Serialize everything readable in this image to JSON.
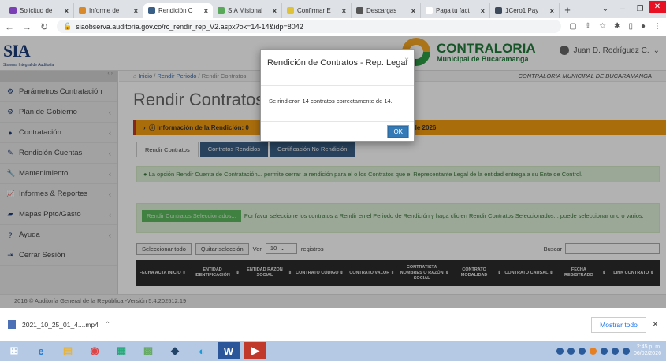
{
  "browser": {
    "tabs": [
      {
        "label": "Solicitud de",
        "color": "#7b3fb5",
        "active": false
      },
      {
        "label": "Informe de",
        "color": "#d9882a",
        "active": false
      },
      {
        "label": "Rendición C",
        "color": "#3a5f86",
        "active": true
      },
      {
        "label": "SIA Misional",
        "color": "#5aa85a",
        "active": false
      },
      {
        "label": "Confirmar E",
        "color": "#e0c23a",
        "active": false
      },
      {
        "label": "Descargas",
        "color": "#555555",
        "active": false
      },
      {
        "label": "Paga tu fact",
        "color": "#ffffff",
        "active": false
      },
      {
        "label": "1Cero1 Pay",
        "color": "#3c4a5c",
        "active": false
      }
    ],
    "new_tab": "+",
    "url": "siaobserva.auditoria.gov.co/rc_rendir_rep_V2.aspx?ok=14-14&idp=8042"
  },
  "header": {
    "logo_text": "SIA",
    "logo_sub": "Sistema Integral de Auditoría",
    "org_title": "CONTRALORIA",
    "org_sub": "Municipal de Bucaramanga",
    "user_name": "Juan D. Rodríguez C."
  },
  "sidebar": {
    "items": [
      {
        "label": "Parámetros Contratación",
        "icon": "gears-icon",
        "glyph": "⚙",
        "chevron": false
      },
      {
        "label": "Plan de Gobierno",
        "icon": "gears-icon",
        "glyph": "⚙",
        "chevron": true
      },
      {
        "label": "Contratación",
        "icon": "circle-icon",
        "glyph": "●",
        "chevron": true
      },
      {
        "label": "Rendición Cuentas",
        "icon": "edit-icon",
        "glyph": "✎",
        "chevron": true
      },
      {
        "label": "Mantenimiento",
        "icon": "wrench-icon",
        "glyph": "🔧",
        "chevron": true
      },
      {
        "label": "Informes & Reportes",
        "icon": "chart-icon",
        "glyph": "📈",
        "chevron": true
      },
      {
        "label": "Mapas Ppto/Gasto",
        "icon": "book-icon",
        "glyph": "▰",
        "chevron": true
      },
      {
        "label": "Ayuda",
        "icon": "question-icon",
        "glyph": "?",
        "chevron": true
      },
      {
        "label": "Cerrar Sesión",
        "icon": "signout-icon",
        "glyph": "⇥",
        "chevron": false
      }
    ]
  },
  "breadcrumb": {
    "home": "Inicio",
    "sep": "/",
    "parent": "Rendir Periodo",
    "current": "Rendir Contratos",
    "entity": "CONTRALORIA MUNICIPAL DE BUCARAMANGA"
  },
  "main": {
    "title": "Rendir Contratos",
    "info_bar_left": "Información de la Rendición: 0",
    "info_bar_right": "de 2026",
    "tabs": [
      "Rendir Contratos",
      "Contratos Rendidos",
      "Certificación No Rendición"
    ],
    "info_text": "La opción Rendir Cuenta de Contratación... permite cerrar la rendición para el o los Contratos que el Representante Legal de la entidad entrega a su Ente de Control.",
    "rendir_button": "Rendir Contratos Seleccionados...",
    "instructions": "Por favor seleccione los contratos a Rendir en el Periodo de Rendición y haga clic en Rendir Contratos Seleccionados... puede seleccionar uno o varios.",
    "select_all": "Seleccionar todo",
    "deselect": "Quitar selección",
    "show_label": "Ver",
    "page_size": "10",
    "records_label": "registros",
    "search_label": "Buscar",
    "columns": [
      "FECHA ACTA INICIO",
      "ENTIDAD IDENTIFICACIÓN",
      "ENTIDAD RAZÓN SOCIAL",
      "CONTRATO CÓDIGO",
      "CONTRATO VALOR",
      "CONTRATISTA NOMBRES O RAZÓN SOCIAL",
      "CONTRATO MODALIDAD",
      "CONTRATO CAUSAL",
      "FECHA REGISTRADO",
      "LINK CONTRATO"
    ]
  },
  "footer": "2016 © Auditoría General de la República -Versión 5.4.202512.19",
  "modal": {
    "title": "Rendición de Contratos - Rep. Legal",
    "message": "Se rindieron 14 contratos correctamente de 14.",
    "ok": "OK"
  },
  "download": {
    "file": "2021_10_25_01_4....mp4",
    "show_all": "Mostrar todo"
  },
  "taskbar": {
    "time": "2:45 p. m.",
    "date": "06/02/2026"
  }
}
